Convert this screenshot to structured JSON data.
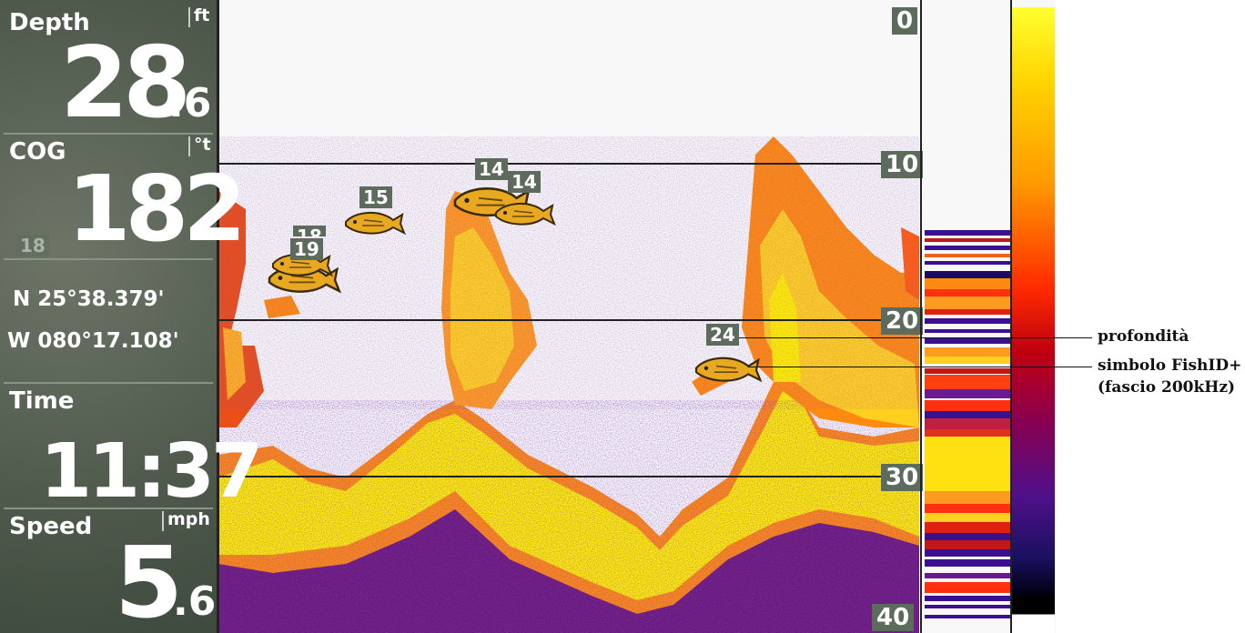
{
  "panel": {
    "depth": {
      "label": "Depth",
      "unit": "ft",
      "value_int": "28",
      "value_dec": ".6"
    },
    "cog": {
      "label": "COG",
      "unit": "°t",
      "value": "182"
    },
    "position": {
      "lat": "N  25°38.379'",
      "lon": "W  080°17.108'"
    },
    "time": {
      "label": "Time",
      "value": "11:37"
    },
    "speed": {
      "label": "Speed",
      "unit": "mph",
      "value_int": "5",
      "value_dec": ".6"
    }
  },
  "depth_scale": {
    "labels": [
      "0",
      "10",
      "20",
      "30",
      "40"
    ]
  },
  "fish_ids": [
    {
      "depth": "15"
    },
    {
      "depth": "19"
    },
    {
      "depth": "18"
    },
    {
      "depth": "14"
    },
    {
      "depth": "14"
    },
    {
      "depth": "24"
    },
    {
      "depth": "18"
    }
  ],
  "annotations": {
    "depth_label": "profondità",
    "fish_symbol_line1": "simbolo FishID+",
    "fish_symbol_line2": "(fascio 200kHz)"
  },
  "colors": {
    "panel_bg": "#586456",
    "label_bg": "#5c6b5c",
    "sonar_yellow": "#ffef00",
    "sonar_orange": "#f08020",
    "sonar_red": "#d01010",
    "sonar_purple": "#3a1a80",
    "background": "#f7f8f7"
  },
  "icons": [
    "fish-icon"
  ]
}
